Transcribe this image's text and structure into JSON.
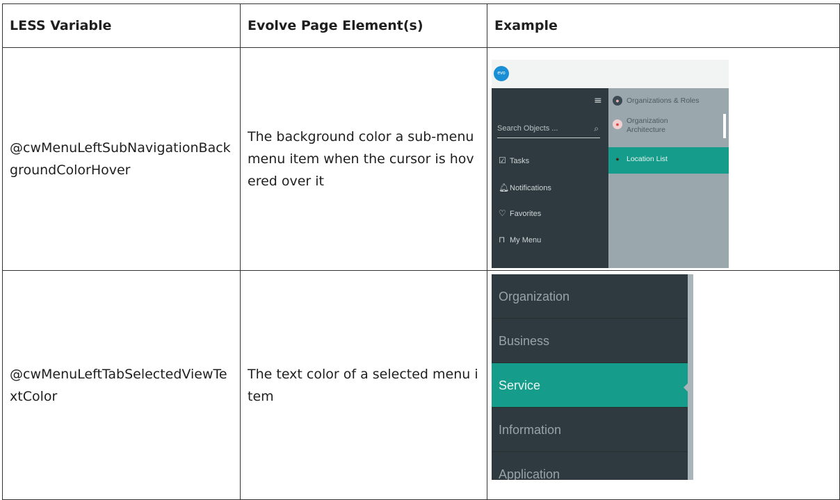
{
  "headers": {
    "variable": "LESS Variable",
    "element": "Evolve Page Element(s)",
    "example": "Example"
  },
  "rows": [
    {
      "variable": "@cwMenuLeftSubNavigationBackgroundColorHover",
      "description": "The background color a sub-menu menu item when the cursor is hovered over it",
      "example": {
        "logo_text": "evo",
        "menu_icon": "hamburger-icon",
        "search_placeholder": "Search Objects ...",
        "nav_items": [
          {
            "icon": "check-square-icon",
            "glyph": "☑",
            "label": "Tasks"
          },
          {
            "icon": "bell-icon",
            "glyph": "🔔︎",
            "label": "Notifications"
          },
          {
            "icon": "heart-icon",
            "glyph": "♡",
            "label": "Favorites"
          },
          {
            "icon": "bookmark-icon",
            "glyph": "⊓",
            "label": "My Menu"
          }
        ],
        "sub_items": [
          {
            "icon": "org-roles-icon",
            "label": "Organizations & Roles"
          },
          {
            "icon": "org-architecture-icon",
            "label": "Organization Architecture"
          },
          {
            "icon": "globe-icon",
            "label": "Location List"
          }
        ],
        "hover_color": "#169c8a"
      }
    },
    {
      "variable": "@cwMenuLeftTabSelectedViewTextColor",
      "description": "The text color of a selected menu item",
      "example": {
        "items": [
          "Organization",
          "Business",
          "Service",
          "Information",
          "Application"
        ],
        "selected": "Service",
        "selected_bg": "#169c8a",
        "menu_bg": "#2e3a3f"
      }
    }
  ]
}
